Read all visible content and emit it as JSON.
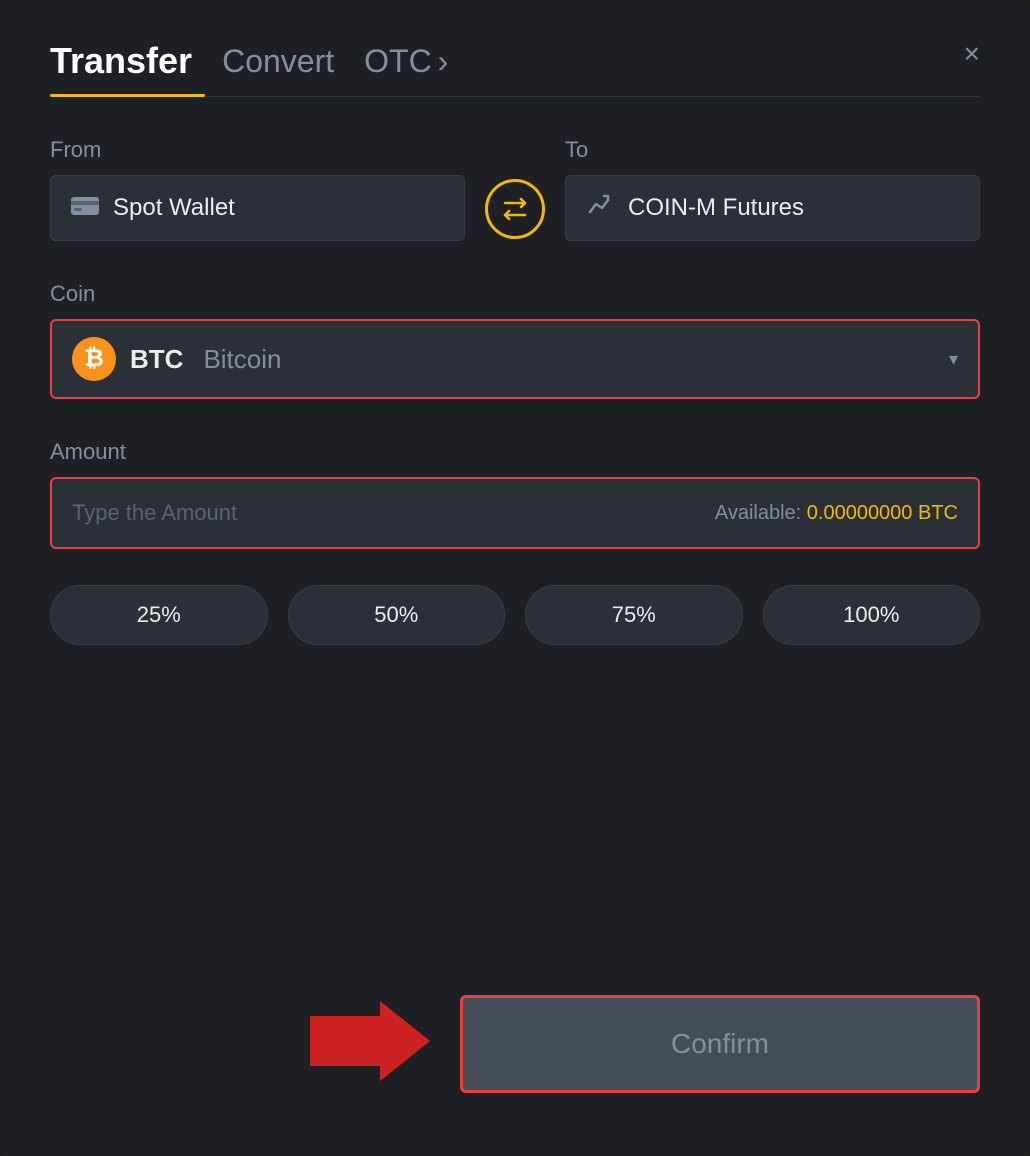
{
  "header": {
    "tab_transfer": "Transfer",
    "tab_convert": "Convert",
    "tab_otc": "OTC",
    "tab_otc_arrow": "›",
    "close_label": "×"
  },
  "from": {
    "label": "From",
    "wallet_icon": "▬",
    "wallet_name": "Spot Wallet"
  },
  "to": {
    "label": "To",
    "wallet_icon": "↑",
    "wallet_name": "COIN-M Futures"
  },
  "swap": {
    "icon": "⇄"
  },
  "coin": {
    "label": "Coin",
    "symbol": "BTC",
    "full_name": "Bitcoin",
    "chevron": "▾"
  },
  "amount": {
    "label": "Amount",
    "placeholder": "Type the Amount",
    "available_label": "Available:",
    "available_value": "0.00000000 BTC"
  },
  "pct_buttons": [
    "25%",
    "50%",
    "75%",
    "100%"
  ],
  "confirm": {
    "label": "Confirm"
  }
}
